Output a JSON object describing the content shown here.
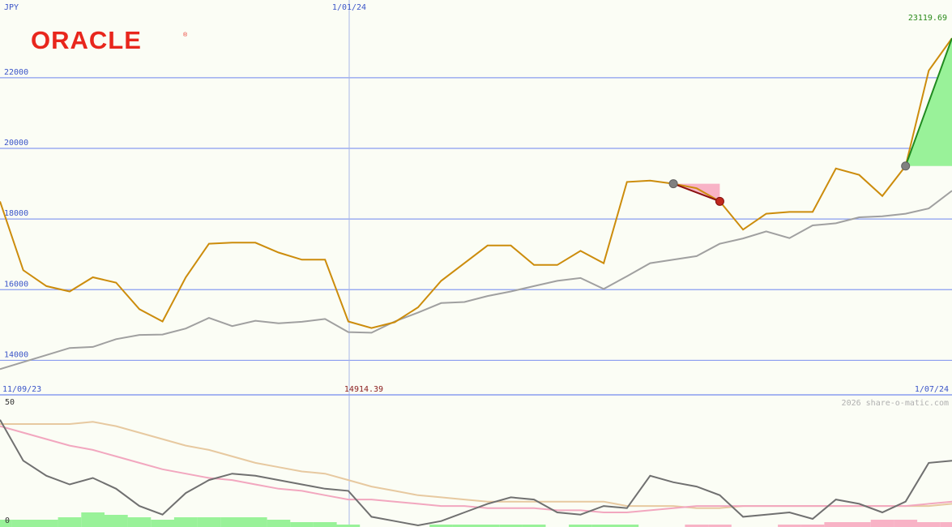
{
  "brand": {
    "logo_text": "ORACLE",
    "color": "#e8261d"
  },
  "header": {
    "currency": "JPY",
    "date_marker": "1/01/24",
    "last_price": "23119.69"
  },
  "footer": {
    "start_date": "11/09/23",
    "min_price": "14914.39",
    "end_date": "1/07/24",
    "watermark": "2026 share-o-matic.com"
  },
  "oscillator": {
    "top_label": "50",
    "bottom_label": "0"
  },
  "colors": {
    "background": "#fbfdf5",
    "grid": "#8a9df0",
    "price_line": "#cc8c0c",
    "average_line": "#a0a0a0",
    "axis_text": "#3b55c8",
    "highlight_text": "#8a1c1c",
    "last_price_text": "#2a8a1a",
    "gain_fill": "#99f299",
    "loss_fill": "#f8b3c6",
    "osc_dark": "#707070",
    "osc_pink": "#f2a7bf",
    "osc_tan": "#e7c9a0"
  },
  "chart_data": {
    "type": "line",
    "xlabel": "",
    "ylabel": "JPY",
    "x_start": "11/09/23",
    "x_end": "1/07/24",
    "ylim": [
      13000,
      24200
    ],
    "yticks": [
      14000,
      16000,
      18000,
      20000,
      22000
    ],
    "series": [
      {
        "role": "price",
        "values": [
          18500,
          16550,
          16100,
          15950,
          16350,
          16200,
          15450,
          15100,
          16350,
          17300,
          17330,
          17330,
          17050,
          16850,
          16850,
          15100,
          14914.39,
          15080,
          15500,
          16250,
          16750,
          17250,
          17250,
          16700,
          16700,
          17100,
          16750,
          19050,
          19090,
          19000,
          18870,
          18500,
          17700,
          18150,
          18200,
          18200,
          19430,
          19250,
          18650,
          19500,
          22200,
          23119.69
        ]
      },
      {
        "role": "moving-average",
        "values": [
          13750,
          13950,
          14150,
          14350,
          14380,
          14600,
          14720,
          14730,
          14900,
          15200,
          14970,
          15120,
          15050,
          15090,
          15170,
          14800,
          14780,
          15100,
          15350,
          15620,
          15650,
          15820,
          15950,
          16100,
          16250,
          16330,
          16020,
          16380,
          16750,
          16850,
          16950,
          17300,
          17450,
          17650,
          17460,
          17820,
          17880,
          18050,
          18080,
          18150,
          18300,
          18800
        ]
      }
    ],
    "signals": [
      {
        "type": "loss",
        "from_index": 29,
        "to_index": 31
      },
      {
        "type": "gain",
        "from_index": 39,
        "to_index": 41
      }
    ],
    "oscillator": {
      "ylim": [
        0,
        50
      ],
      "series": [
        {
          "role": "dark",
          "values": [
            49,
            30,
            23,
            19,
            22,
            17,
            9,
            5,
            15,
            21,
            24,
            23,
            21,
            19,
            17,
            16,
            4,
            2,
            0,
            2,
            6,
            10,
            13,
            12,
            6,
            5,
            9,
            8,
            23,
            20,
            18,
            14,
            4,
            5,
            6,
            3,
            12,
            10,
            6,
            11,
            29,
            30
          ]
        },
        {
          "role": "pink",
          "values": [
            46,
            43,
            40,
            37,
            35,
            32,
            29,
            26,
            24,
            22,
            21,
            19,
            17,
            16,
            14,
            12,
            12,
            11,
            10,
            9,
            9,
            8,
            8,
            8,
            7,
            7,
            6,
            6,
            7,
            8,
            9,
            9,
            9,
            9,
            9,
            9,
            9,
            9,
            9,
            9,
            10,
            11
          ]
        },
        {
          "role": "tan",
          "values": [
            47,
            47,
            47,
            47,
            48,
            46,
            43,
            40,
            37,
            35,
            32,
            29,
            27,
            25,
            24,
            21,
            18,
            16,
            14,
            13,
            12,
            11,
            11,
            11,
            11,
            11,
            11,
            9,
            9,
            9,
            8,
            8,
            9,
            9,
            9,
            9,
            9,
            9,
            9,
            9,
            9,
            10
          ]
        }
      ],
      "bars": [
        3,
        3,
        3,
        4,
        6,
        5,
        4,
        3,
        4,
        4,
        4,
        4,
        3,
        2,
        2,
        1,
        0,
        0,
        0,
        1,
        1,
        1,
        1,
        1,
        0,
        1,
        1,
        1,
        0,
        0,
        -1,
        -1,
        0,
        0,
        -1,
        -1,
        -2,
        -2,
        -3,
        -3,
        -2,
        -2
      ]
    }
  }
}
